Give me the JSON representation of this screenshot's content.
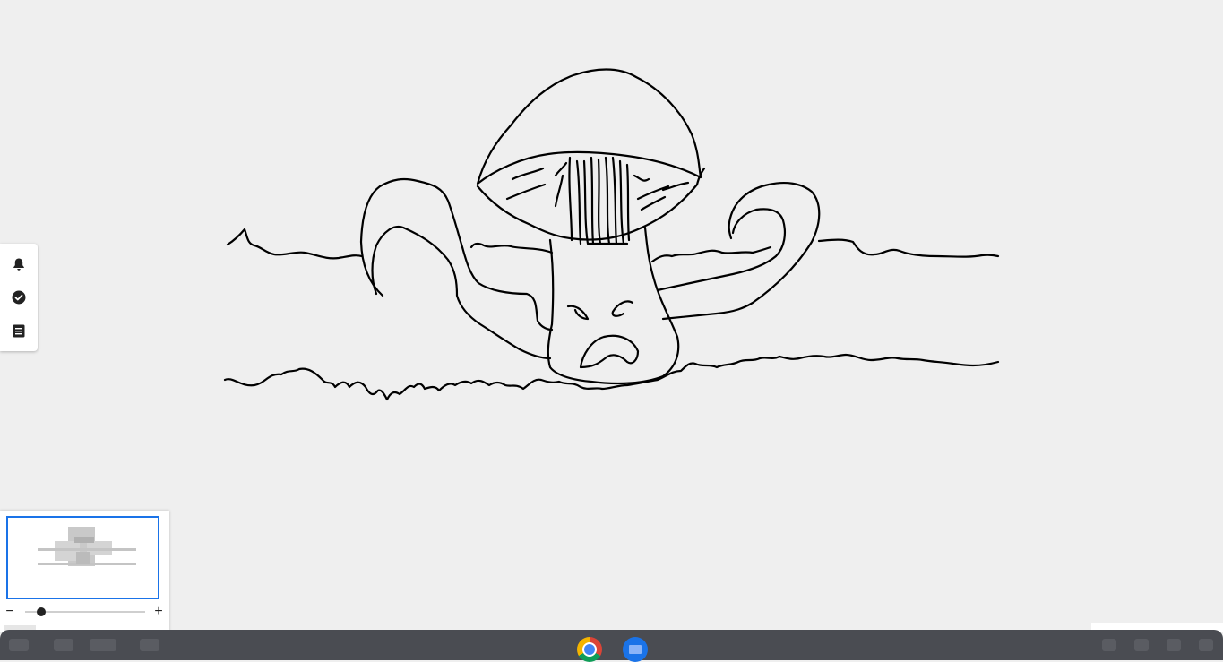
{
  "canvas": {
    "drawing": "mushroom-sketch"
  },
  "side_toolbar": {
    "items": [
      {
        "icon": "bell-icon"
      },
      {
        "icon": "check-circle-icon"
      },
      {
        "icon": "list-icon"
      }
    ]
  },
  "minimap": {
    "zoom_out_label": "−",
    "zoom_in_label": "+",
    "zoom_level": 0.1
  },
  "taskbar": {
    "apps": [
      {
        "icon": "chrome-icon"
      },
      {
        "icon": "files-icon"
      }
    ]
  }
}
